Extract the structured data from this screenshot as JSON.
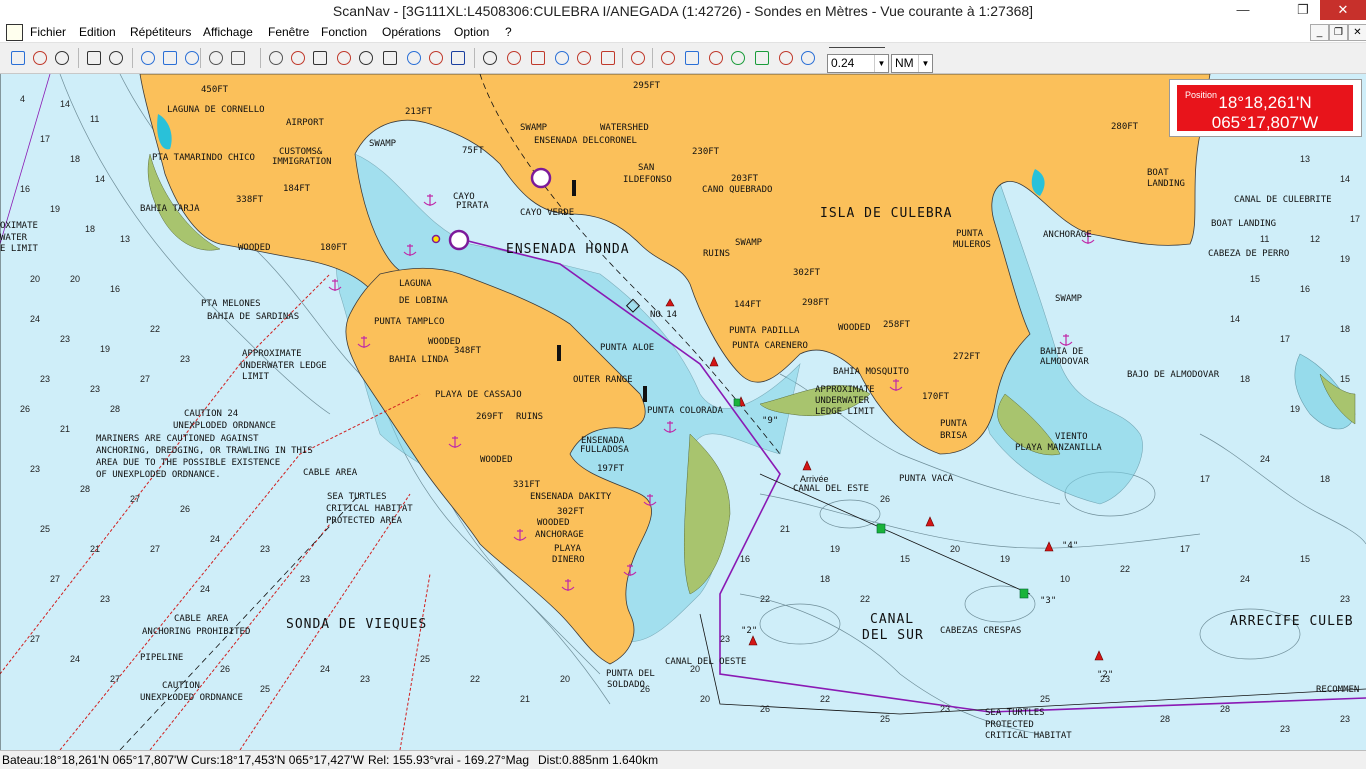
{
  "window": {
    "title": "ScanNav - [3G111XL:L4508306:CULEBRA I/ANEGADA (1:42726) - Sondes en  Mètres  - Vue courante à 1:27368]",
    "controls": {
      "minimize": "—",
      "maximize": "❐",
      "close": "✕"
    },
    "mdi_controls": {
      "minimize": "_",
      "restore": "❐",
      "close": "✕"
    }
  },
  "menu": [
    "Fichier",
    "Edition",
    "Répétiteurs",
    "Affichage",
    "Fenêtre",
    "Fonction",
    "Opérations",
    "Option",
    "?"
  ],
  "toolbar": {
    "zoom_value": "0.24",
    "unit_value": "NM",
    "icons": [
      "new-chart-icon",
      "open-chart-icon",
      "save-icon",
      "help-cursor-icon",
      "print-icon",
      "help-icon",
      "zoom-in-icon",
      "zoom-out-icon",
      "hand-pan-icon",
      "select-rectangle-icon",
      "zoom-rectangle-icon",
      "boat-icon",
      "waypoint-icon",
      "route-icon",
      "track-icon",
      "edit-route-icon",
      "measure-icon",
      "tide-icon",
      "text-tool-icon",
      "layers-icon",
      "gps-icon",
      "nmea-icon",
      "compass-icon",
      "target-icon",
      "auto-icon",
      "anchor-icon",
      "lifebuoy-icon",
      "instruments-icon",
      "image-icon",
      "waypoint-list-icon",
      "route-list-icon",
      "track-list-icon",
      "arrow-right-icon",
      "statistics-icon"
    ]
  },
  "position_panel": {
    "caption": "Position",
    "lat": "18°18,261'N",
    "lon": "065°17,807'W",
    "accent_color": "#e8141b"
  },
  "chart": {
    "sea_color": "#cfeef9",
    "land_color": "#fbc05a",
    "shallow_color": "#7fd4e6",
    "route_color": "#8a1ab4",
    "labels": {
      "laguna_cornello": "LAGUNA DE CORNELLO",
      "airport": "AIRPORT",
      "pta_tamarindo": "PTA TAMARINDO CHICO",
      "customs": "CUSTOMS&",
      "immigration": "IMMIGRATION",
      "bahia_tarja": "BAHIA TARJA",
      "ft450": "450FT",
      "ft213": "213FT",
      "ft338": "338FT",
      "ft184": "184FT",
      "ft75": "75FT",
      "ft180": "180FT",
      "ft295": "295FT",
      "ft230": "230FT",
      "ft203": "203FT",
      "ft280": "280FT",
      "ft302": "302FT",
      "ft144": "144FT",
      "ft298": "298FT",
      "ft258": "258FT",
      "ft272": "272FT",
      "ft170": "170FT",
      "ft348": "348FT",
      "ft269": "269FT",
      "ft197": "197FT",
      "ft331": "331FT",
      "ft302b": "302FT",
      "wooded1": "WOODED",
      "wooded2": "WOODED",
      "wooded3": "WOODED",
      "wooded4": "WOODED",
      "wooded5": "WOODED",
      "swamp1": "SWAMP",
      "swamp2": "SWAMP",
      "swamp3": "SWAMP",
      "swamp4": "SWAMP",
      "watershed": "WATERSHED",
      "ensenada_delcoronel": "ENSENADA DELCORONEL",
      "san_ildefonso1": "SAN",
      "san_ildefonso2": "ILDEFONSO",
      "cano_quebrado": "CANO QUEBRADO",
      "isla_culebra": "ISLA DE CULEBRA",
      "cayo_pirata1": "CAYO",
      "cayo_pirata2": "PIRATA",
      "cayo_verde": "CAYO VERDE",
      "ensenada_honda": "ENSENADA HONDA",
      "ruins1": "RUINS",
      "ruins2": "RUINS",
      "punta_muleros1": "PUNTA",
      "punta_muleros2": "MULEROS",
      "anchorage1": "ANCHORAGE",
      "anchorage2": "ANCHORAGE",
      "boat_landing1": "BOAT",
      "boat_landing2": "LANDING",
      "boat_landing3": "BOAT LANDING",
      "canal_culebrite": "CANAL DE CULEBRITE",
      "cabeza_perro": "CABEZA DE PERRO",
      "laguna_lobina1": "LAGUNA",
      "laguna_lobina2": "DE LOBINA",
      "pta_melones": "PTA MELONES",
      "bahia_sardinas": "BAHIA DE SARDINAS",
      "punta_tamplco": "PUNTA TAMPLCO",
      "bahia_linda": "BAHIA LINDA",
      "approx1": "APPROXIMATE",
      "approx2": "UNDERWATER LEDGE",
      "approx3": "LIMIT",
      "playa_cassajo": "PLAYA DE CASSAJO",
      "punta_padilla": "PUNTA PADILLA",
      "punta_carenero": "PUNTA CARENERO",
      "punta_aloe": "PUNTA ALOE",
      "outer_range": "OUTER RANGE",
      "punta_colorada": "PUNTA COLORADA",
      "ensenada_fulladosa1": "ENSENADA",
      "ensenada_fulladosa2": "FULLADOSA",
      "ensenada_dakity": "ENSENADA DAKITY",
      "playa_dinero1": "PLAYA",
      "playa_dinero2": "DINERO",
      "bahia_mosquito": "BAHIA MOSQUITO",
      "approx4": "APPROXIMATE",
      "approx5": "UNDERWATER",
      "approx6": "LEDGE LIMIT",
      "canal_este": "CANAL DEL ESTE",
      "punta_vaca": "PUNTA VACA",
      "punta_brisa1": "PUNTA",
      "punta_brisa2": "BRISA",
      "viento": "VIENTO",
      "playa_manzanilla": "PLAYA MANZANILLA",
      "bajo_almodovar": "BAJO DE ALMODOVAR",
      "bahia_almodovar1": "BAHIA DE",
      "bahia_almodovar2": "ALMODOVAR",
      "caution1": "CAUTION 24",
      "caution2": "UNEXPLODED ORDNANCE",
      "mariners1": "MARINERS ARE CAUTIONED AGAINST",
      "mariners2": "ANCHORING, DREDGING, OR TRAWLING IN THIS",
      "mariners3": "AREA DUE TO THE POSSIBLE EXISTENCE",
      "mariners4": "OF UNEXPLODED ORDNANCE.",
      "cable_area1": "CABLE AREA",
      "sea_turtles1": "SEA TURTLES",
      "sea_turtles2": "CRITICAL HABITAT",
      "sea_turtles3": "PROTECTED AREA",
      "cable_area2": "CABLE AREA",
      "anchoring_prohibited": "ANCHORING PROHIBITED",
      "pipeline": "PIPELINE",
      "caution3": "CAUTION",
      "caution4": "UNEXPLODED ORDNANCE",
      "sonda_vieques": "SONDA DE VIEQUES",
      "canal_sur1": "CANAL",
      "canal_sur2": "DEL SUR",
      "cabezas_crespas": "CABEZAS CRESPAS",
      "arrecife": "ARRECIFE CULEB",
      "canal_oeste": "CANAL DEL OESTE",
      "punta_soldado1": "PUNTA DEL",
      "punta_soldado2": "SOLDADO",
      "sea_turtles4": "SEA TURTLES",
      "sea_turtles5": "PROTECTED",
      "sea_turtles6": "CRITICAL HABITAT",
      "recommen": "RECOMMEN",
      "arrivee": "Arrivée",
      "oximate": "OXIMATE",
      "water": "WATER",
      "e_limit": "E LIMIT",
      "no14": "NO 14",
      "buoy2a": "\"2\"",
      "buoy2b": "\"2\"",
      "buoy3": "\"3\"",
      "buoy4": "\"4\"",
      "buoy9": "\"9\""
    }
  },
  "status": {
    "bateau": "Bateau:18°18,261'N 065°17,807'W",
    "curseur": "Curs:18°17,453'N 065°17,427'W",
    "relevement": "Rel: 155.93°vrai - 169.27°Mag",
    "distance": "Dist:0.885nm  1.640km"
  }
}
